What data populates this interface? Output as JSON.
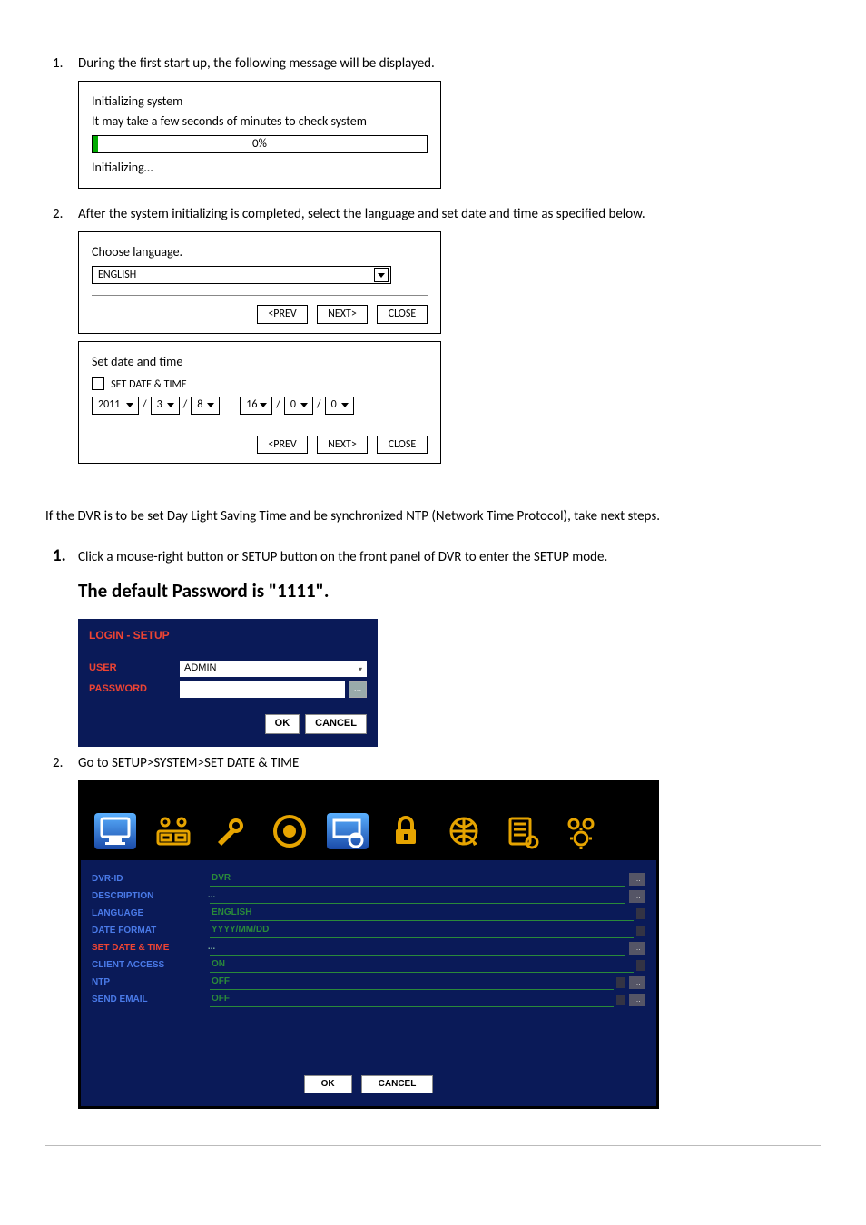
{
  "step1": {
    "num": "1.",
    "text": "During the first start up, the following message will be displayed.",
    "dialog": {
      "line1": "Initializing system",
      "line2": "It may take a few seconds of minutes to check system",
      "pct": "0%",
      "status": "Initializing…"
    }
  },
  "step2": {
    "num": "2.",
    "text": "After the system initializing is completed, select the language and set date and time as specified below.",
    "lang_dialog": {
      "title": "Choose language.",
      "value": "ENGLISH",
      "prev": "<PREV",
      "next": "NEXT>",
      "close": "CLOSE"
    },
    "date_dialog": {
      "title": "Set date and time",
      "label": "SET DATE & TIME",
      "year": "2011",
      "mon": "3",
      "day": "8",
      "hour": "16",
      "min": "0",
      "sec": "0",
      "slash": "/",
      "prev": "<PREV",
      "next": "NEXT>",
      "close": "CLOSE"
    }
  },
  "ntp_para": "If the DVR is to be set Day Light Saving Time and be synchronized NTP (Network Time Protocol), take next steps.",
  "step_setup1": {
    "num": "1.",
    "text": "Click a mouse-right button or SETUP button on the front panel of DVR to enter the SETUP mode."
  },
  "default_pw": "The default Password is \"1111\".",
  "login": {
    "title": "LOGIN - SETUP",
    "user_lbl": "USER",
    "user_val": "ADMIN",
    "pw_lbl": "PASSWORD",
    "ok": "OK",
    "cancel": "CANCEL",
    "dots": "..."
  },
  "step_setup2": {
    "num": "2.",
    "text": "Go to SETUP>SYSTEM>SET DATE & TIME"
  },
  "setup": {
    "rows": [
      {
        "lbl": "DVR-ID",
        "val": "DVR",
        "hot": false,
        "more": true,
        "dd": false
      },
      {
        "lbl": "DESCRIPTION",
        "val": "",
        "hot": false,
        "more": true,
        "dd": false,
        "centerDots": true
      },
      {
        "lbl": "LANGUAGE",
        "val": "ENGLISH",
        "hot": false,
        "more": false,
        "dd": true
      },
      {
        "lbl": "DATE FORMAT",
        "val": "YYYY/MM/DD",
        "hot": false,
        "more": false,
        "dd": true
      },
      {
        "lbl": "SET DATE & TIME",
        "val": "",
        "hot": true,
        "more": true,
        "dd": false,
        "centerDots": true
      },
      {
        "lbl": "CLIENT ACCESS",
        "val": "ON",
        "hot": false,
        "more": false,
        "dd": true
      },
      {
        "lbl": "NTP",
        "val": "OFF",
        "hot": false,
        "more": true,
        "dd": true
      },
      {
        "lbl": "SEND EMAIL",
        "val": "OFF",
        "hot": false,
        "more": true,
        "dd": true
      }
    ],
    "ok": "OK",
    "cancel": "CANCEL",
    "dots": "..."
  }
}
